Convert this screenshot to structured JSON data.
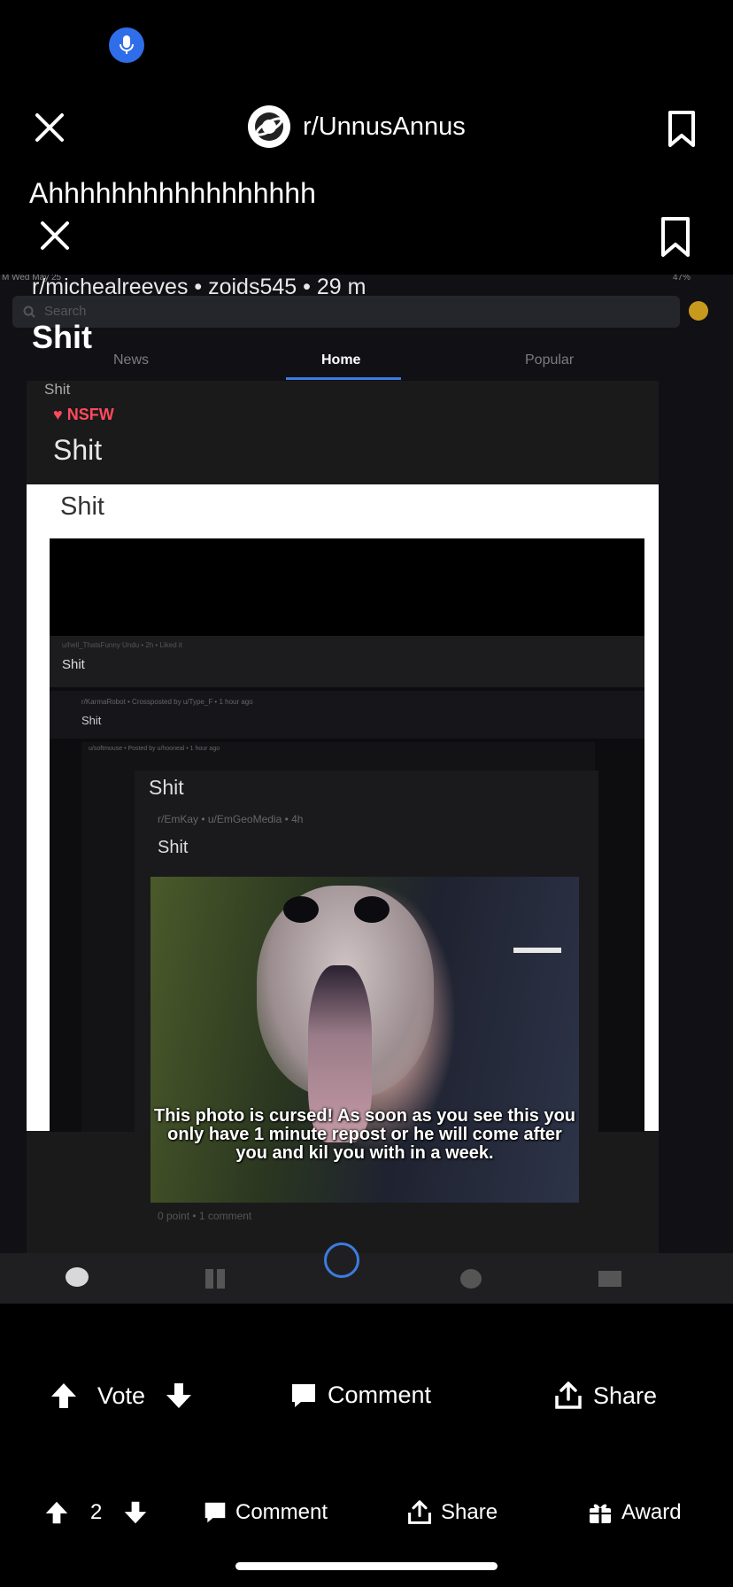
{
  "top_bar": {
    "subreddit": "r/UnnusAnnus"
  },
  "post": {
    "title": "Ahhhhhhhhhhhhhhhhh",
    "meta": "r/michealreeves • zoids545 • 29 m",
    "flair_title": "Shit"
  },
  "embedded_screenshot": {
    "status_left": "M  Wed May 25",
    "status_right": "47%",
    "search_placeholder": "Search",
    "tabs": [
      "News",
      "Home",
      "Popular"
    ],
    "active_tab": "Home",
    "lines": {
      "shit_small": "Shit",
      "nsfw": "NSFW",
      "shit_large": "Shit",
      "shit_white": "Shit",
      "shit_nested1": "Shit",
      "shit_nested2": "Shit",
      "shit_nested3": "Shit",
      "shit_nested4": "Shit",
      "credit_small": "u/hell_ThatsFunny Undu • 2h • Liked it",
      "credit_rk": "r/KarmaRobot • Crossposted by u/Type_F • 1 hour ago",
      "credit_nested": "u/softmouse • Posted by u/hooneal • 1 hour ago",
      "credit_emkay": "r/EmKay • u/EmGeoMedia • 4h",
      "points": "0 point • 1 comment"
    },
    "photo_caption": "This photo is cursed! As soon as you see this you only have 1 minute repost or he will come after you and kil you with in a week."
  },
  "actions": {
    "vote_label": "Vote",
    "comment_label": "Comment",
    "share_label": "Share"
  },
  "bottom_bar": {
    "score": "2",
    "comment_label": "Comment",
    "share_label": "Share",
    "award_label": "Award"
  },
  "colors": {
    "mic": "#2f6ee8",
    "nsfw": "#ff4a5e",
    "tab_underline": "#3d7be0"
  }
}
